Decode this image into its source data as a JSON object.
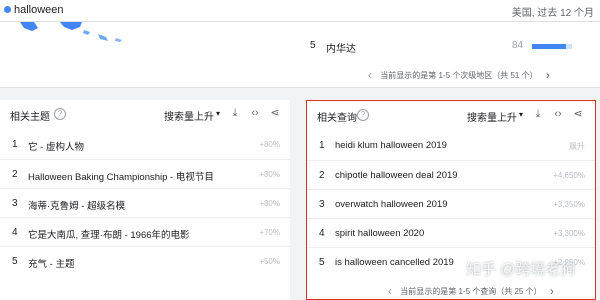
{
  "search": {
    "term": "halloween",
    "dot_color": "#4285f4"
  },
  "region": "美国, 过去 12 个月",
  "map_section": {
    "row": {
      "rank": "5",
      "name": "内华达",
      "value": "84",
      "fill_fraction": 0.84
    },
    "pager": {
      "text": "当前显示的是第 1-5 个次级地区（共 51 个）",
      "prev": "‹",
      "next": "›"
    }
  },
  "topics": {
    "title": "相关主题",
    "help": "?",
    "sort": "搜索量上升",
    "caret": "▾",
    "icons": {
      "download": "⤓",
      "embed": "‹›",
      "share": "⋖"
    },
    "rows": [
      {
        "rank": "1",
        "label": "它 - 虚构人物",
        "value": "+80%"
      },
      {
        "rank": "2",
        "label": "Halloween Baking Championship - 电视节目",
        "value": "+80%"
      },
      {
        "rank": "3",
        "label": "海蒂·克鲁姆 - 超级名模",
        "value": "+80%"
      },
      {
        "rank": "4",
        "label": "它是大南瓜, 查理·布朗 - 1966年的电影",
        "value": "+70%"
      },
      {
        "rank": "5",
        "label": "充气 - 主题",
        "value": "+50%"
      }
    ]
  },
  "queries": {
    "title": "相关查询",
    "help": "?",
    "sort": "搜索量上升",
    "caret": "▾",
    "icons": {
      "download": "⤓",
      "embed": "‹›",
      "share": "⋖"
    },
    "rows": [
      {
        "rank": "1",
        "label": "heidi klum halloween 2019",
        "value": "飙升"
      },
      {
        "rank": "2",
        "label": "chipotle halloween deal 2019",
        "value": "+4,650%"
      },
      {
        "rank": "3",
        "label": "overwatch halloween 2019",
        "value": "+3,350%"
      },
      {
        "rank": "4",
        "label": "spirit halloween 2020",
        "value": "+3,300%"
      },
      {
        "rank": "5",
        "label": "is halloween cancelled 2019",
        "value": "+2,950%"
      }
    ],
    "pager": {
      "text": "当前显示的是第 1-5 个查询（共 25 个）",
      "prev": "‹",
      "next": "›"
    },
    "border_color": "#d93025"
  },
  "watermark": "知乎 @跨境老狗"
}
